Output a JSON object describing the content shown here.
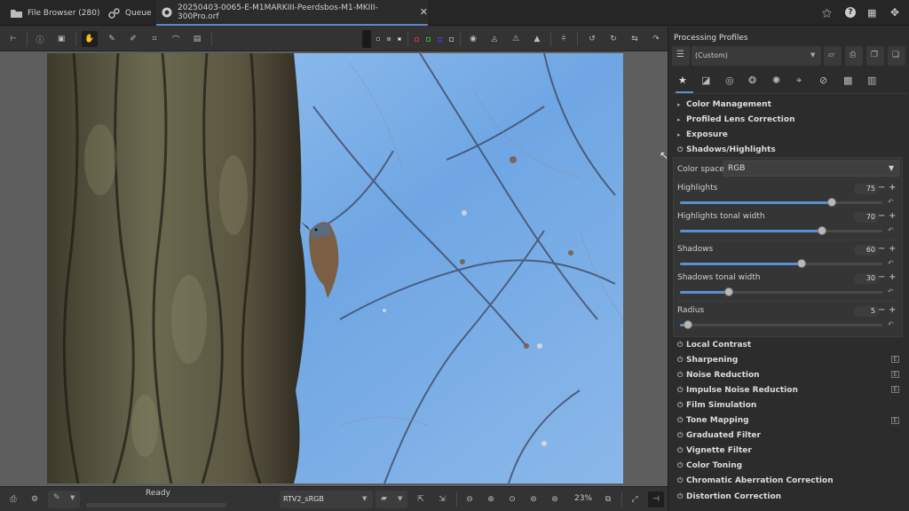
{
  "tabs": [
    {
      "label": "File Browser (280)",
      "icon": "folder-icon"
    },
    {
      "label": "Queue",
      "icon": "gears-icon"
    },
    {
      "label": "20250403-0065-E-M1MARKIII-Peerdsbos-M1-MKIII-300Pro.orf",
      "icon": "aperture-icon"
    }
  ],
  "status": {
    "text": "Ready"
  },
  "output_profile": "RTV2_sRGB",
  "zoom": "23%",
  "profiles": {
    "title": "Processing Profiles",
    "current": "(Custom)"
  },
  "sections_top": [
    {
      "label": "Color Management",
      "state": "collapsed"
    },
    {
      "label": "Profiled Lens Correction",
      "state": "collapsed"
    },
    {
      "label": "Exposure",
      "state": "collapsed"
    },
    {
      "label": "Shadows/Highlights",
      "state": "expanded"
    }
  ],
  "shadows_highlights": {
    "color_space_label": "Color space:",
    "color_space_value": "RGB",
    "sliders": [
      {
        "label": "Highlights",
        "value": "75",
        "fraction": 0.75
      },
      {
        "label": "Highlights tonal width",
        "value": "70",
        "fraction": 0.7
      },
      {
        "label": "Shadows",
        "value": "60",
        "fraction": 0.6
      },
      {
        "label": "Shadows tonal width",
        "value": "30",
        "fraction": 0.24
      },
      {
        "label": "Radius",
        "value": "5",
        "fraction": 0.04
      }
    ]
  },
  "sections_bottom": [
    {
      "label": "Local Contrast",
      "badge": false
    },
    {
      "label": "Sharpening",
      "badge": true
    },
    {
      "label": "Noise Reduction",
      "badge": true
    },
    {
      "label": "Impulse Noise Reduction",
      "badge": true
    },
    {
      "label": "Film Simulation",
      "badge": false
    },
    {
      "label": "Tone Mapping",
      "badge": true
    },
    {
      "label": "Graduated Filter",
      "badge": false
    },
    {
      "label": "Vignette Filter",
      "badge": false
    },
    {
      "label": "Color Toning",
      "badge": false
    },
    {
      "label": "Chromatic Aberration Correction",
      "badge": false
    },
    {
      "label": "Distortion Correction",
      "badge": false
    }
  ],
  "colors": {
    "accent": "#5a8fd0",
    "panel_bg": "#2c2c2c",
    "canvas_bg": "#5e5e5e",
    "sky": "#7eb0e8",
    "bark": "#4a4535"
  }
}
